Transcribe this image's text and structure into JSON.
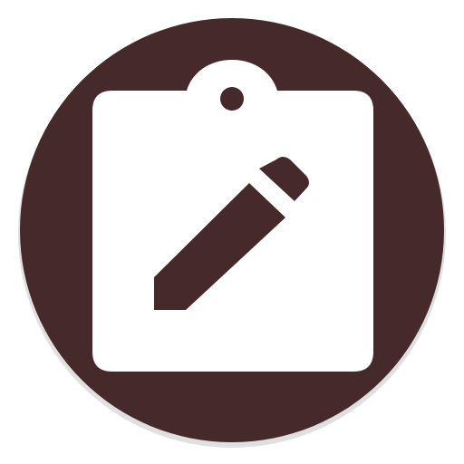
{
  "icon": {
    "name": "clipboard-edit-icon",
    "background_color": "#45292b",
    "foreground_color": "#ffffff",
    "glyphs": [
      "clipboard-icon",
      "pencil-icon"
    ]
  }
}
